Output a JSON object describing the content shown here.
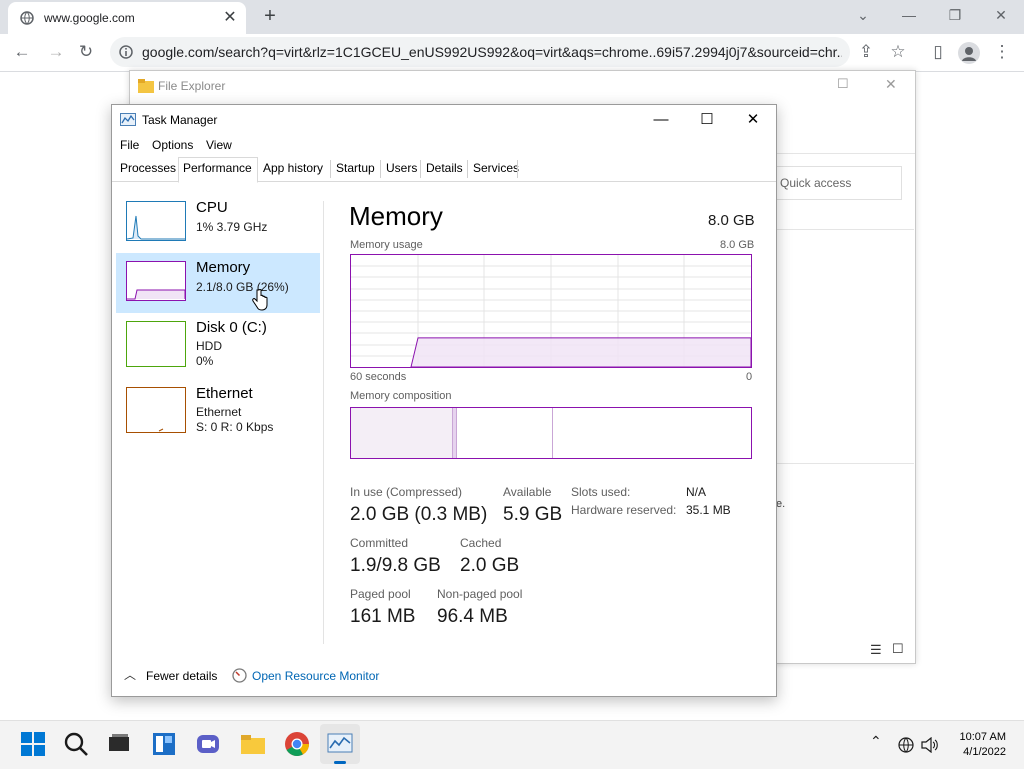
{
  "browser": {
    "tab_title": "www.google.com",
    "url": "google.com/search?q=virt&rlz=1C1GCEU_enUS992US992&oq=virt&aqs=chrome..69i57.2994j0j7&sourceid=chr..."
  },
  "file_explorer": {
    "title": "File Explorer",
    "quick_access": "Quick access",
    "partial_text": "e."
  },
  "task_manager": {
    "title": "Task Manager",
    "menu": [
      "File",
      "Options",
      "View"
    ],
    "tabs": [
      "Processes",
      "Performance",
      "App history",
      "Startup",
      "Users",
      "Details",
      "Services"
    ],
    "active_tab": "Performance",
    "resources": [
      {
        "name": "CPU",
        "line1": "1% 3.79 GHz",
        "line2": "",
        "color": "#1f7ab6"
      },
      {
        "name": "Memory",
        "line1": "2.1/8.0 GB (26%)",
        "line2": "",
        "color": "#8b12ae"
      },
      {
        "name": "Disk 0 (C:)",
        "line1": "HDD",
        "line2": "0%",
        "color": "#4da60c"
      },
      {
        "name": "Ethernet",
        "line1": "Ethernet",
        "line2": "S: 0 R: 0 Kbps",
        "color": "#a74f01"
      }
    ],
    "main": {
      "heading": "Memory",
      "total": "8.0 GB",
      "usage_label": "Memory usage",
      "usage_max": "8.0 GB",
      "time_left": "60 seconds",
      "time_right": "0",
      "composition_label": "Memory composition",
      "usage_fraction": 0.26,
      "stats": {
        "in_use_label": "In use (Compressed)",
        "in_use_value": "2.0 GB (0.3 MB)",
        "available_label": "Available",
        "available_value": "5.9 GB",
        "committed_label": "Committed",
        "committed_value": "1.9/9.8 GB",
        "cached_label": "Cached",
        "cached_value": "2.0 GB",
        "paged_label": "Paged pool",
        "paged_value": "161 MB",
        "nonpaged_label": "Non-paged pool",
        "nonpaged_value": "96.4 MB",
        "slots_label": "Slots used:",
        "slots_value": "N/A",
        "hw_label": "Hardware reserved:",
        "hw_value": "35.1 MB"
      }
    },
    "footer": {
      "fewer": "Fewer details",
      "resmon": "Open Resource Monitor"
    }
  },
  "taskbar": {
    "time": "10:07 AM",
    "date": "4/1/2022"
  },
  "colors": {
    "memory": "#8b12ae",
    "link": "#0066b4",
    "selection": "#cce8ff"
  }
}
